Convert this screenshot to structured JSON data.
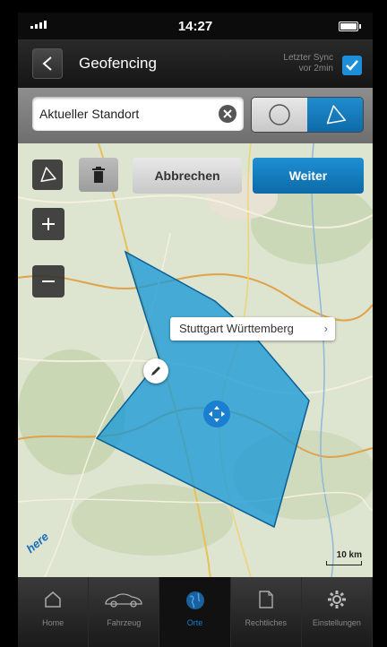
{
  "statusbar": {
    "time": "14:27"
  },
  "navbar": {
    "title": "Geofencing",
    "sync_line1": "Letzter Sync",
    "sync_line2": "vor 2min",
    "sync_checked": true
  },
  "search": {
    "value": "Aktueller Standort"
  },
  "mode_toggle": {
    "options": [
      "circle",
      "polygon"
    ],
    "selected": "polygon"
  },
  "map": {
    "toolbar": {
      "cancel_label": "Abbrechen",
      "next_label": "Weiter"
    },
    "callout_label": "Stuttgart Württemberg",
    "logo_text": "here",
    "scale_label": "10 km"
  },
  "tabbar": {
    "items": [
      {
        "label": "Home",
        "icon": "home-icon"
      },
      {
        "label": "Fahrzeug",
        "icon": "car-icon"
      },
      {
        "label": "Orte",
        "icon": "globe-icon"
      },
      {
        "label": "Rechtliches",
        "icon": "document-icon"
      },
      {
        "label": "Einstellungen",
        "icon": "gear-icon"
      }
    ],
    "active": "Orte"
  },
  "colors": {
    "accent": "#1a7fd0",
    "geofence_fill": "#1a9ad6",
    "map_bg": "#dfe5d2"
  }
}
